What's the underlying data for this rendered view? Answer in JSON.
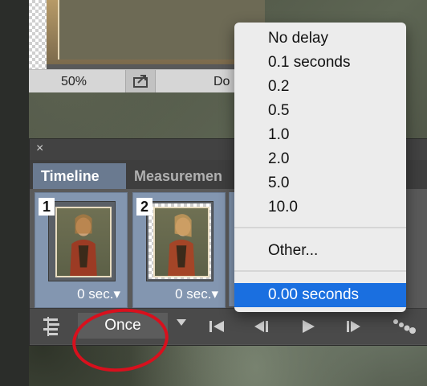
{
  "document": {
    "zoom": "50%",
    "status_text": "Do"
  },
  "panel": {
    "close_glyph": "×",
    "tabs": [
      {
        "label": "Timeline"
      },
      {
        "label": "Measuremen"
      }
    ],
    "frames": [
      {
        "number": "1",
        "delay": "0 sec.▾"
      },
      {
        "number": "2",
        "delay": "0 sec.▾"
      }
    ],
    "loop": {
      "label": "Once"
    }
  },
  "delay_menu": {
    "items": [
      "No delay",
      "0.1 seconds",
      "0.2",
      "0.5",
      "1.0",
      "2.0",
      "5.0",
      "10.0"
    ],
    "other": "Other...",
    "current": "0.00 seconds"
  },
  "colors": {
    "accent": "#1a6fe0",
    "annotation": "#d8101d"
  }
}
